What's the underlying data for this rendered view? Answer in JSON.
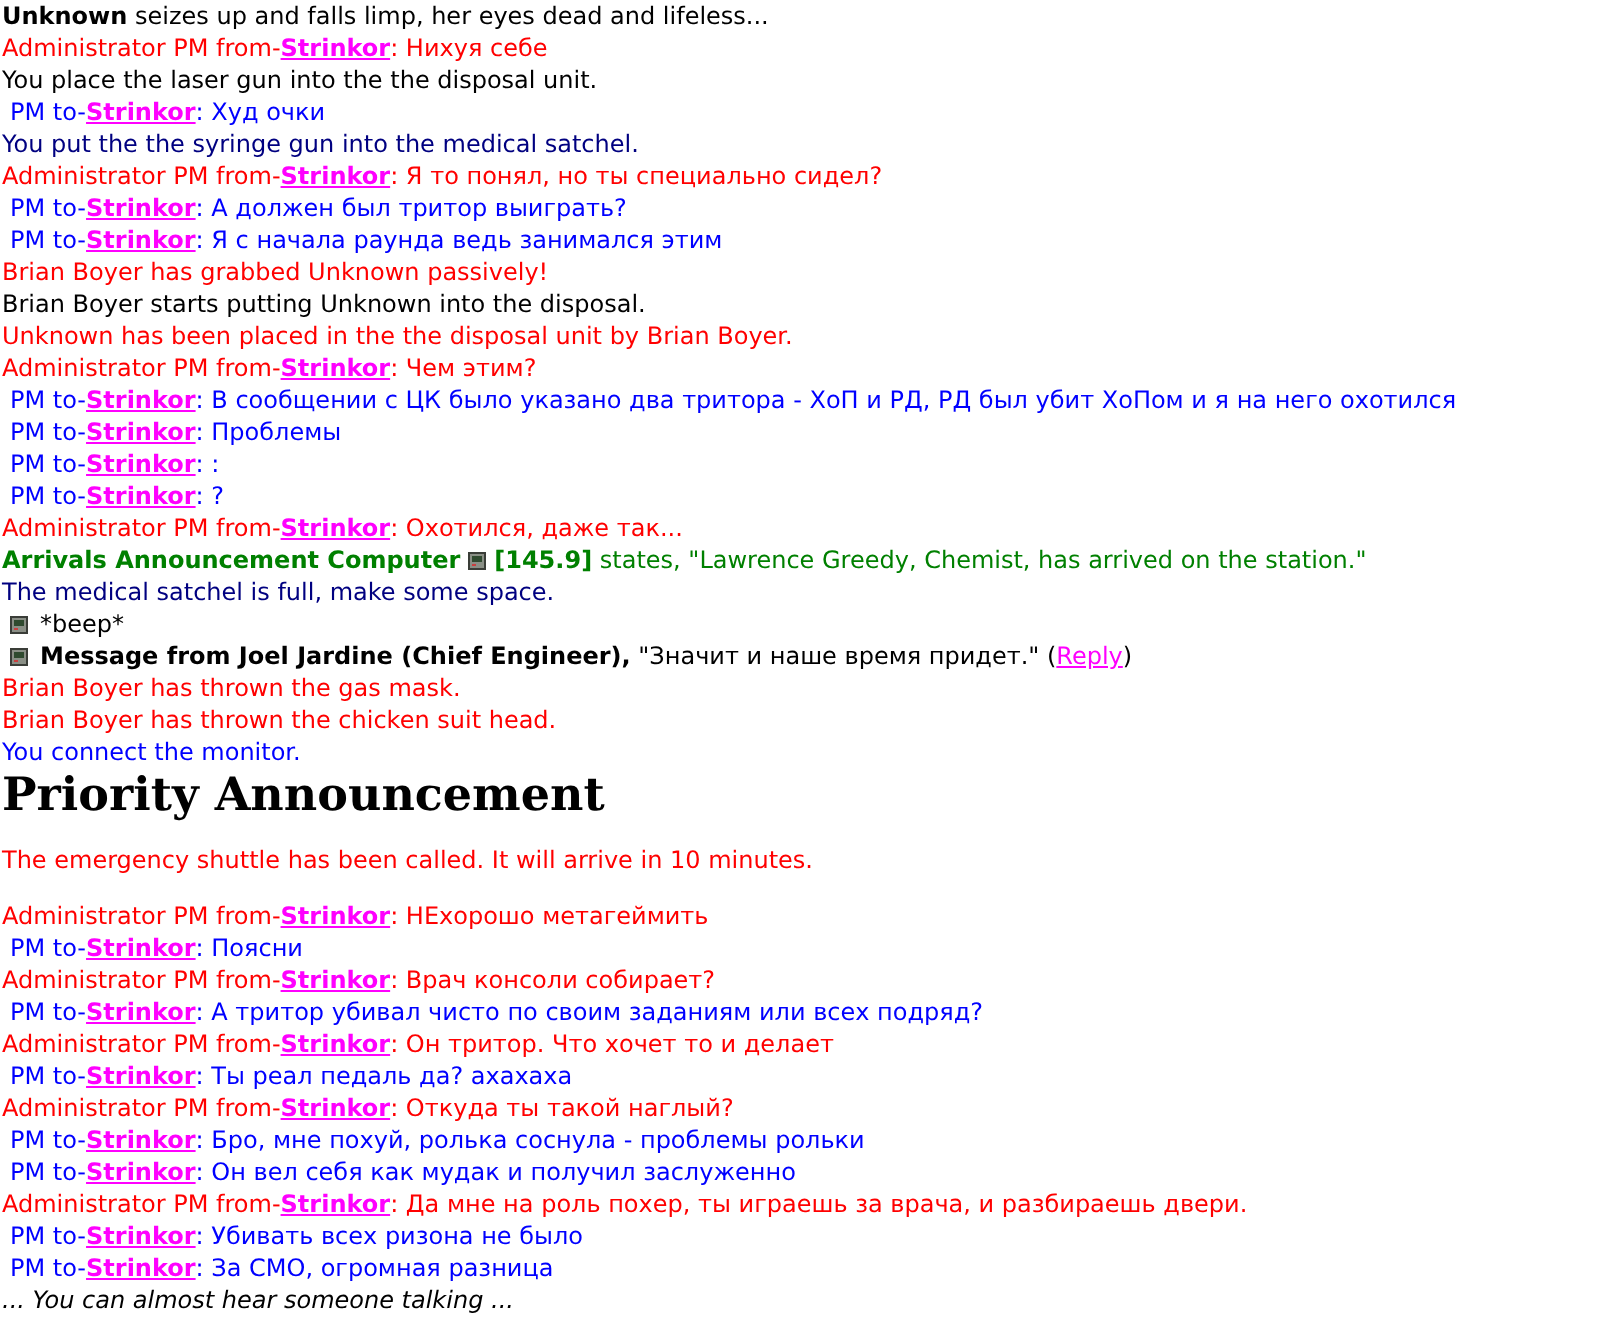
{
  "messages": [
    {
      "kind": "emote",
      "name": "Unknown",
      "text": "seizes up and falls limp, her eyes dead and lifeless..."
    },
    {
      "kind": "pm_from",
      "prefix": "Administrator PM from-",
      "sender": "Strinkor",
      "text": ": Нихуя себе"
    },
    {
      "kind": "notice",
      "color": "#000000",
      "text": "You place the laser gun into the the disposal unit."
    },
    {
      "kind": "pm_to",
      "prefix": "PM to-",
      "sender": "Strinkor",
      "text": ": Худ очки"
    },
    {
      "kind": "notice",
      "color": "#000080",
      "text": "You put the the syringe gun into the medical satchel."
    },
    {
      "kind": "pm_from",
      "prefix": "Administrator PM from-",
      "sender": "Strinkor",
      "text": ": Я то понял, но ты специально сидел?"
    },
    {
      "kind": "pm_to",
      "prefix": "PM to-",
      "sender": "Strinkor",
      "text": ": А должен был тритор выиграть?"
    },
    {
      "kind": "pm_to",
      "prefix": "PM to-",
      "sender": "Strinkor",
      "text": ": Я с начала раунда ведь занимался этим"
    },
    {
      "kind": "notice",
      "color": "#ff0000",
      "text": "Brian Boyer has grabbed Unknown passively!"
    },
    {
      "kind": "notice",
      "color": "#000000",
      "text": "Brian Boyer starts putting Unknown into the disposal."
    },
    {
      "kind": "notice",
      "color": "#ff0000",
      "text": "Unknown has been placed in the the disposal unit by Brian Boyer."
    },
    {
      "kind": "pm_from",
      "prefix": "Administrator PM from-",
      "sender": "Strinkor",
      "text": ": Чем этим?"
    },
    {
      "kind": "pm_to",
      "prefix": "PM to-",
      "sender": "Strinkor",
      "text": ": В сообщении с ЦК было указано два тритора - ХоП и РД, РД был убит ХоПом и я на него охотился"
    },
    {
      "kind": "pm_to",
      "prefix": "PM to-",
      "sender": "Strinkor",
      "text": ": Проблемы"
    },
    {
      "kind": "pm_to",
      "prefix": "PM to-",
      "sender": "Strinkor",
      "text": ": :"
    },
    {
      "kind": "pm_to",
      "prefix": "PM to-",
      "sender": "Strinkor",
      "text": ": ?"
    },
    {
      "kind": "pm_from",
      "prefix": "Administrator PM from-",
      "sender": "Strinkor",
      "text": ": Охотился, даже так..."
    },
    {
      "kind": "radio",
      "speaker": "Arrivals Announcement Computer",
      "frequency": "[145.9]",
      "text": "states, \"Lawrence Greedy, Chemist, has arrived on the station.\""
    },
    {
      "kind": "notice",
      "color": "#000080",
      "text": "The medical satchel is full, make some space."
    },
    {
      "kind": "pda",
      "text": "*beep*"
    },
    {
      "kind": "pda_message",
      "title": "Message from Joel Jardine (Chief Engineer),",
      "text": "\"Значит и наше время придет.\" (",
      "link": "Reply",
      "tail": ")"
    },
    {
      "kind": "notice",
      "color": "#ff0000",
      "text": "Brian Boyer has thrown the gas mask."
    },
    {
      "kind": "notice",
      "color": "#ff0000",
      "text": "Brian Boyer has thrown the chicken suit head."
    },
    {
      "kind": "notice",
      "color": "#0000ff",
      "text": "You connect the monitor."
    },
    {
      "kind": "announcement",
      "title": "Priority Announcement",
      "text": "The emergency shuttle has been called. It will arrive in 10 minutes."
    },
    {
      "kind": "pm_from",
      "prefix": "Administrator PM from-",
      "sender": "Strinkor",
      "text": ": НЕхорошо метагеймить"
    },
    {
      "kind": "pm_to",
      "prefix": "PM to-",
      "sender": "Strinkor",
      "text": ": Поясни"
    },
    {
      "kind": "pm_from",
      "prefix": "Administrator PM from-",
      "sender": "Strinkor",
      "text": ": Врач консоли собирает?"
    },
    {
      "kind": "pm_to",
      "prefix": "PM to-",
      "sender": "Strinkor",
      "text": ": А тритор убивал чисто по своим заданиям или всех подряд?"
    },
    {
      "kind": "pm_from",
      "prefix": "Administrator PM from-",
      "sender": "Strinkor",
      "text": ": Он тритор. Что хочет то и делает"
    },
    {
      "kind": "pm_to",
      "prefix": "PM to-",
      "sender": "Strinkor",
      "text": ": Ты реал педаль да? ахахаха"
    },
    {
      "kind": "pm_from",
      "prefix": "Administrator PM from-",
      "sender": "Strinkor",
      "text": ": Откуда ты такой наглый?"
    },
    {
      "kind": "pm_to",
      "prefix": "PM to-",
      "sender": "Strinkor",
      "text": ": Бро, мне похуй, ролька соснула - проблемы рольки"
    },
    {
      "kind": "pm_to",
      "prefix": "PM to-",
      "sender": "Strinkor",
      "text": ": Он вел себя как мудак и получил заслуженно"
    },
    {
      "kind": "pm_from",
      "prefix": "Administrator PM from-",
      "sender": "Strinkor",
      "text": ": Да мне на роль похер, ты играешь за врача, и разбираешь двери."
    },
    {
      "kind": "pm_to",
      "prefix": "PM to-",
      "sender": "Strinkor",
      "text": ": Убивать всех ризона не было"
    },
    {
      "kind": "pm_to",
      "prefix": "PM to-",
      "sender": "Strinkor",
      "text": ": За СМО, огромная разница"
    },
    {
      "kind": "deadchat",
      "text": "... You can almost hear someone talking ..."
    }
  ]
}
